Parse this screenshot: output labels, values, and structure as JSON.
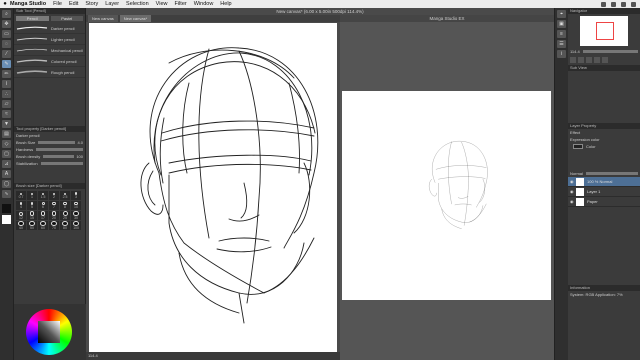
{
  "menubar": {
    "app": "Manga Studio",
    "items": [
      "File",
      "Edit",
      "Story",
      "Layer",
      "Selection",
      "View",
      "Filter",
      "Window",
      "Help"
    ]
  },
  "window": {
    "title": "New canvas* (6.00 x 5.00in 500dpi 114.4%)",
    "subtitle": "Manga Studio EX"
  },
  "canvas_tabs": [
    "New canvas",
    "New canvas*"
  ],
  "status_zoom": "114.4",
  "left_panel": {
    "subtool_header": "Sub Tool [Pencil]",
    "tabs": [
      "Pencil",
      "Pastel"
    ],
    "subtools": [
      "Darker pencil",
      "Lighter pencil",
      "Mechanical pencil",
      "Colored pencil",
      "Rough pencil"
    ],
    "tool_property_header": "Tool property [Darker pencil]",
    "tool_property_name": "Darker pencil",
    "props": [
      {
        "label": "Brush Size",
        "value": "4.0"
      },
      {
        "label": "Hardness",
        "value": ""
      },
      {
        "label": "Brush density",
        "value": "100"
      },
      {
        "label": "Stabilization",
        "value": ""
      }
    ],
    "brush_size_header": "Brush size [Darker pencil]",
    "brush_sizes": [
      "0.7",
      "1",
      "1.5",
      "2",
      "2.5",
      "3",
      "4",
      "5",
      "6",
      "7",
      "8",
      "10",
      "12",
      "15",
      "17",
      "20",
      "25",
      "30",
      "40",
      "50",
      "60",
      "70",
      "80",
      "100"
    ]
  },
  "right_panel": {
    "navigator_header": "Navigator",
    "navigator_zoom": "114.4",
    "sub_view_header": "Sub View",
    "layer_property_header": "Layer Property",
    "effect_label": "Effect",
    "expression_color_label": "Expression color",
    "expression_color_value": "Color",
    "blend_mode": "Normal",
    "layers": [
      {
        "name": "100 % Normal",
        "selected": true
      },
      {
        "name": "Layer 1",
        "selected": false
      },
      {
        "name": "Paper",
        "selected": false
      }
    ],
    "info_header": "Information",
    "info_text": "System: RGB Application: 7%"
  },
  "colors": {
    "accent": "#4d6f95",
    "paper": "#ffffff",
    "ui_dark": "#3b3b3b"
  }
}
